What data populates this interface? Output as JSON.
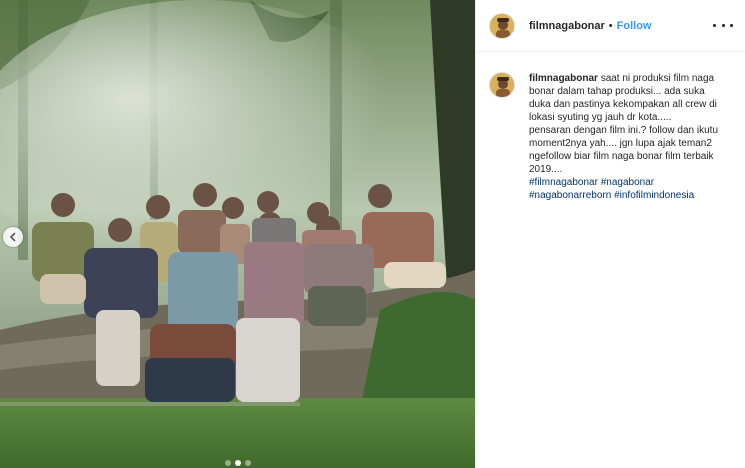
{
  "post": {
    "username": "filmnagabonar",
    "separator": "•",
    "follow_label": "Follow",
    "caption_text": "saat ni produksi film naga bonar dalam tahap produksi... ada suka duka dan pastinya kekompakan all crew di lokasi syuting yg jauh dr kota.....\npensaran dengan film ini.? follow dan ikutu moment2nya yah.... jgn lupa ajak teman2 ngefollow biar film naga bonar film terbaik 2019....",
    "hashtags": [
      "#filmnagabonar",
      "#nagabonar",
      "#nagabonarreborn",
      "#infofilmindonesia"
    ]
  },
  "icons": {
    "more": "more-options-icon",
    "prev": "chevron-left-icon"
  },
  "colors": {
    "link_blue": "#3897f0",
    "hashtag": "#003569",
    "text": "#262626"
  }
}
